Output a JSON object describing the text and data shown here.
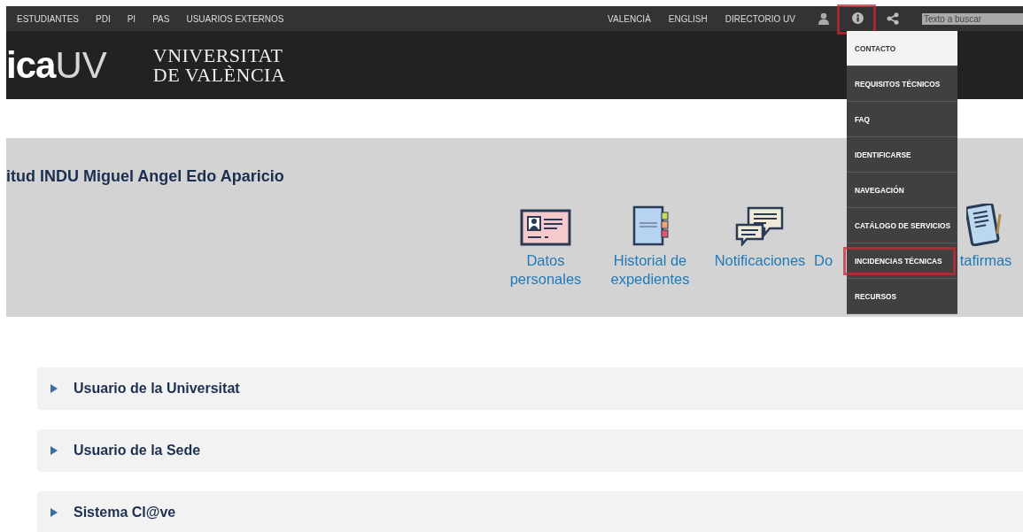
{
  "top_nav": {
    "audience_links": [
      "ESTUDIANTES",
      "PDI",
      "PI",
      "PAS",
      "USUARIOS EXTERNOS"
    ],
    "utility_links": [
      "VALENCIÀ",
      "ENGLISH",
      "DIRECTORIO UV"
    ],
    "info_button": {
      "highlighted": true
    },
    "search": {
      "placeholder": "Texto a buscar"
    }
  },
  "header": {
    "logo_text": "ica",
    "logo_suffix": "UV",
    "university_line_1": "VNIVERSITAT",
    "university_line_2": "DE VALÈNCIA"
  },
  "info_menu": [
    {
      "label": "CONTACTO",
      "selected": true,
      "highlighted": false
    },
    {
      "label": "REQUISITOS TÉCNICOS",
      "selected": false,
      "highlighted": false
    },
    {
      "label": "FAQ",
      "selected": false,
      "highlighted": false
    },
    {
      "label": "IDENTIFICARSE",
      "selected": false,
      "highlighted": false
    },
    {
      "label": "NAVEGACIÓN",
      "selected": false,
      "highlighted": false
    },
    {
      "label": "CATÁLOGO DE SERVICIOS",
      "selected": false,
      "highlighted": false
    },
    {
      "label": "INCIDENCIAS TÉCNICAS",
      "selected": false,
      "highlighted": true
    },
    {
      "label": "RECURSOS",
      "selected": false,
      "highlighted": false
    }
  ],
  "panel": {
    "title": "itud INDU Miguel Angel Edo Aparicio",
    "tiles": [
      {
        "label_lines": [
          "Datos",
          "personales"
        ]
      },
      {
        "label_lines": [
          "Historial de",
          "expedientes"
        ]
      },
      {
        "label_lines": [
          "Notificaciones"
        ]
      },
      {
        "label_lines": [
          "Do"
        ]
      },
      {
        "label_lines": [
          "tafirmas"
        ]
      }
    ]
  },
  "access_sections": [
    {
      "label": "Usuario de la Universitat",
      "expanded": false
    },
    {
      "label": "Usuario de la Sede",
      "expanded": false
    },
    {
      "label": "Sistema Cl@ve",
      "expanded": false
    }
  ]
}
